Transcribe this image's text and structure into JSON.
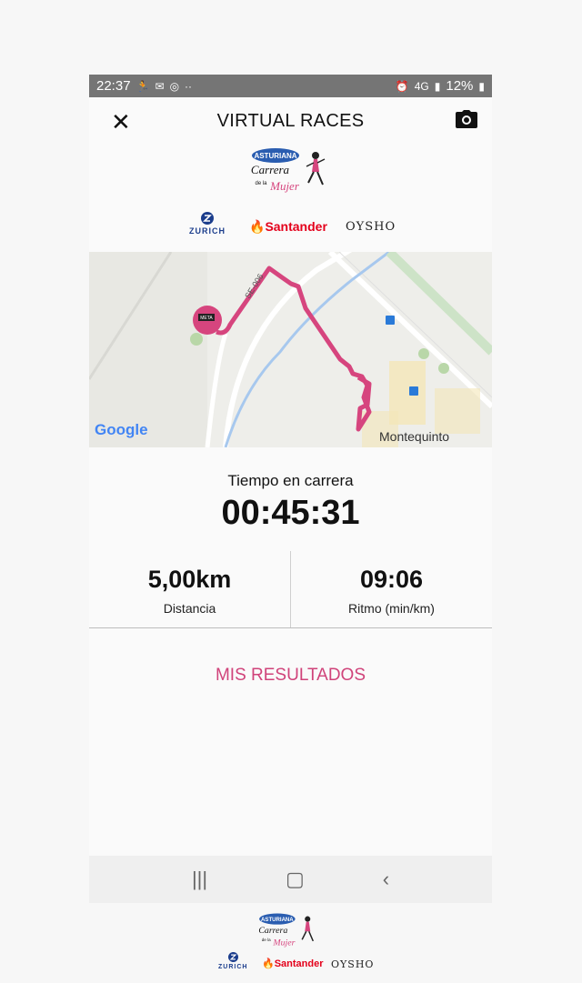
{
  "status_bar": {
    "time": "22:37",
    "network": "4G",
    "battery": "12%"
  },
  "app_bar": {
    "title": "VIRTUAL RACES",
    "close_icon": "close-icon",
    "camera_icon": "camera-icon"
  },
  "race_logo": {
    "brand": "ASTURIANA",
    "line1": "Carrera",
    "line2": "de la",
    "line3": "Mujer"
  },
  "sponsors": {
    "zurich": "ZURICH",
    "santander": "Santander",
    "oysho": "OYSHO"
  },
  "map": {
    "road_label": "SE-006",
    "place": "Montequinto",
    "google": "Google",
    "start_marker": "META",
    "route_color": "#d6457e"
  },
  "stats": {
    "time_label": "Tiempo en carrera",
    "time_value": "00:45:31",
    "distance_value": "5,00km",
    "distance_label": "Distancia",
    "pace_value": "09:06",
    "pace_label": "Ritmo (min/km)"
  },
  "results_button": "MIS RESULTADOS",
  "navbar": {
    "recent": "|||",
    "home": "▢",
    "back": "‹"
  }
}
